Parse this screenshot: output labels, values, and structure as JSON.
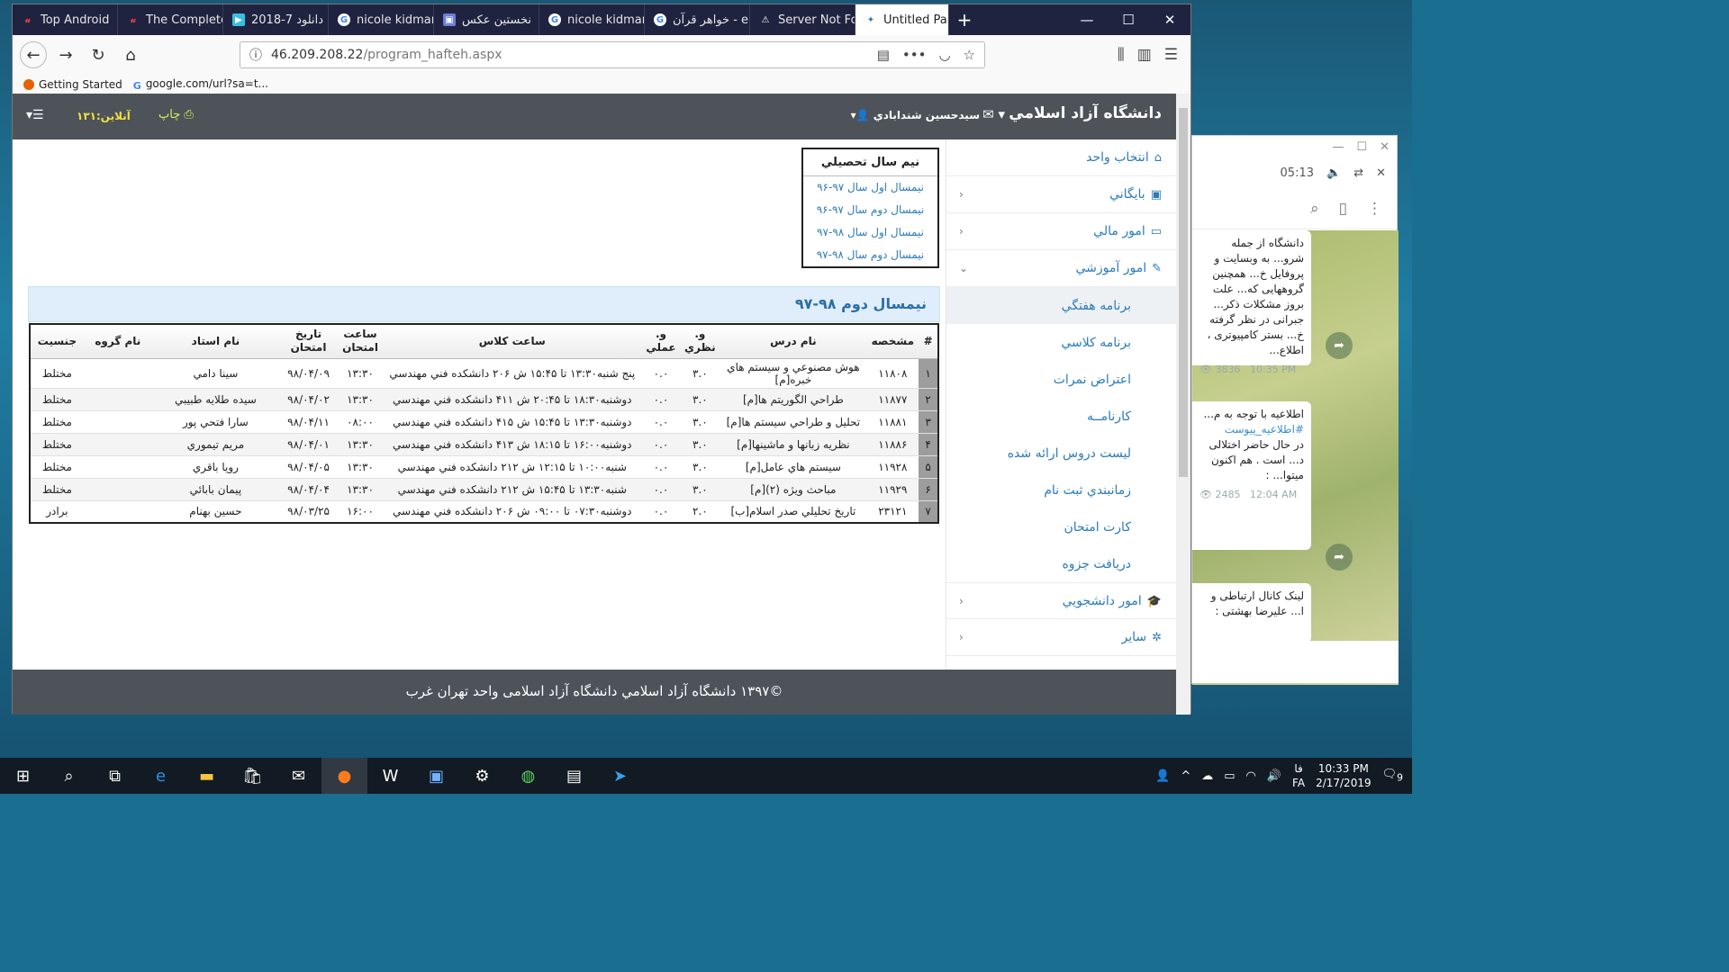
{
  "browser": {
    "tabs": [
      {
        "label": "Top Android",
        "icon": "letter-u-icon",
        "color": "#e04040"
      },
      {
        "label": "The Complete",
        "icon": "letter-u-icon",
        "color": "#e04040"
      },
      {
        "label": "دانلود 7-2018",
        "icon": "play-icon",
        "color": "#35c0e0"
      },
      {
        "label": "nicole kidman",
        "icon": "google-icon",
        "color": "#ffffff"
      },
      {
        "label": "نخستین عکس",
        "icon": "image-icon",
        "color": "#6c7fd8"
      },
      {
        "label": "nicole kidman",
        "icon": "google-icon",
        "color": "#ffffff"
      },
      {
        "label": "خواهر قرآن - e",
        "icon": "google-icon",
        "color": "#ffffff"
      },
      {
        "label": "Server Not Fo",
        "icon": "warning-icon",
        "color": "#ffffff"
      },
      {
        "label": "Untitled Pa",
        "icon": "page-icon",
        "color": "#2b7bb9",
        "active": true
      }
    ],
    "url_host": "46.209.208.22",
    "url_path": "/program_hafteh.aspx",
    "bookmarks": [
      {
        "label": "Getting Started",
        "icon": "firefox-icon"
      },
      {
        "label": "google.com/url?sa=t...",
        "icon": "google-icon"
      }
    ]
  },
  "header": {
    "brand": "دانشگاه آزاد اسلامي",
    "user": "سيدحسين شندابادي",
    "print": "چاپ",
    "online": "آنلاين:۱۳۱"
  },
  "sidebar": [
    {
      "label": "انتخاب واحد",
      "icon": "home-icon"
    },
    {
      "label": "بايگاني",
      "icon": "archive-icon",
      "chevron": true
    },
    {
      "label": "امور مالي",
      "icon": "money-icon",
      "chevron": true
    },
    {
      "label": "امور آموزشي",
      "icon": "pencil-icon",
      "chevron": true,
      "open": true
    },
    {
      "label": "امور دانشجويي",
      "icon": "graduation-icon",
      "chevron": true
    },
    {
      "label": "ساير",
      "icon": "settings-icon",
      "chevron": true
    }
  ],
  "submenu": [
    "برنامه هفتگي",
    "برنامه کلاسي",
    "اعتراض نمرات",
    "کارنامــه",
    "ليست دروس ارائه شده",
    "زمانبندي ثبت نام",
    "کارت امتحان",
    "دريافت جزوه"
  ],
  "semesters": {
    "title": "نيم سال تحصيلي",
    "items": [
      "نيمسال اول سال ۹۷-۹۶",
      "نيمسال دوم سال ۹۷-۹۶",
      "نيمسال اول سال ۹۸-۹۷",
      "نيمسال دوم سال ۹۸-۹۷"
    ]
  },
  "panel_title": "نيمسال دوم ۹۸-۹۷",
  "table": {
    "headers": [
      "#",
      "مشخصه",
      "نام درس",
      "و. نظري",
      "و. عملي",
      "ساعت كلاس",
      "ساعت امتحان",
      "تاريخ امتحان",
      "نام استاد",
      "نام گروه",
      "جنسيت"
    ],
    "rows": [
      [
        "۱",
        "۱۱۸۰۸",
        "هوش مصنوعي و سيستم هاي خبره[م]",
        "۳.۰",
        "۰.۰",
        "پنج شنبه۱۳:۳۰ تا ۱۵:۴۵ ش ۲۰۶ دانشکده فني مهندسي",
        "۱۳:۳۰",
        "۹۸/۰۴/۰۹",
        "سينا دامي",
        "",
        "مختلط"
      ],
      [
        "۲",
        "۱۱۸۷۷",
        "طراحي الگوريتم ها[م]",
        "۳.۰",
        "۰.۰",
        "دوشنبه۱۸:۳۰ تا ۲۰:۴۵ ش ۴۱۱ دانشکده فني مهندسي",
        "۱۳:۳۰",
        "۹۸/۰۴/۰۲",
        "سيده طلايه طبيبي",
        "",
        "مختلط"
      ],
      [
        "۳",
        "۱۱۸۸۱",
        "تحليل و طراحي سيستم ها[م]",
        "۳.۰",
        "۰.۰",
        "دوشنبه۱۳:۳۰ تا ۱۵:۴۵ ش ۴۱۵ دانشکده فني مهندسي",
        "۰۸:۰۰",
        "۹۸/۰۴/۱۱",
        "سارا فتحي پور",
        "",
        "مختلط"
      ],
      [
        "۴",
        "۱۱۸۸۶",
        "نظريه زبانها و ماشينها[م]",
        "۳.۰",
        "۰.۰",
        "دوشنبه۱۶:۰۰ تا ۱۸:۱۵ ش ۴۱۳ دانشکده فني مهندسي",
        "۱۳:۳۰",
        "۹۸/۰۴/۰۱",
        "مريم تيموري",
        "",
        "مختلط"
      ],
      [
        "۵",
        "۱۱۹۲۸",
        "سيستم هاي عامل[م]",
        "۳.۰",
        "۰.۰",
        "شنبه۱۰:۰۰ تا ۱۲:۱۵ ش ۲۱۲ دانشکده فني مهندسي",
        "۱۳:۳۰",
        "۹۸/۰۴/۰۵",
        "رويا باقري",
        "",
        "مختلط"
      ],
      [
        "۶",
        "۱۱۹۲۹",
        "مباحث ويژه (۲)[م]",
        "۳.۰",
        "۰.۰",
        "شنبه۱۳:۳۰ تا ۱۵:۴۵ ش ۲۱۲ دانشکده فني مهندسي",
        "۱۳:۳۰",
        "۹۸/۰۴/۰۴",
        "پيمان بابائي",
        "",
        "مختلط"
      ],
      [
        "۷",
        "۲۳۱۲۱",
        "تاريخ تحليلي صدر اسلام[ب]",
        "۲.۰",
        "۰.۰",
        "دوشنبه۰۷:۳۰ تا ۰۹:۰۰ ش ۲۰۶ دانشکده فني مهندسي",
        "۱۶:۰۰",
        "۹۸/۰۳/۲۵",
        "حسين بهنام",
        "",
        "برادر"
      ]
    ]
  },
  "footer": "©۱۳۹۷ دانشگاه آزاد اسلامي دانشگاه آزاد اسلامی واحد تهران غرب",
  "telegram": {
    "time": "05:13",
    "messages": [
      {
        "text": "دانشگاه از جمله شرو... به وبسایت و پروفایل خ... همچنین گروههایی که... علت بروز مشکلات ذکر... جبرانی در نظر گرفته خ... بستر کامپیوتری ، اطلاع...",
        "views": "3836",
        "time": "10:35 PM"
      },
      {
        "text": "اطلاعیه با توجه به م...",
        "tag": "#اطلاعیه_پیوست",
        "text2": "در حال حاضر اختلالی د... است . هم اکنون میتوا... :",
        "views": "2485",
        "time": "12:04 AM"
      },
      {
        "text": "لینک کانال ارتباطی و ا... علیرضا بهشتی :"
      }
    ]
  },
  "taskbar": {
    "time": "10:33 PM",
    "date": "2/17/2019",
    "lang": "FA",
    "lang2": "فا",
    "notifications": "9"
  }
}
